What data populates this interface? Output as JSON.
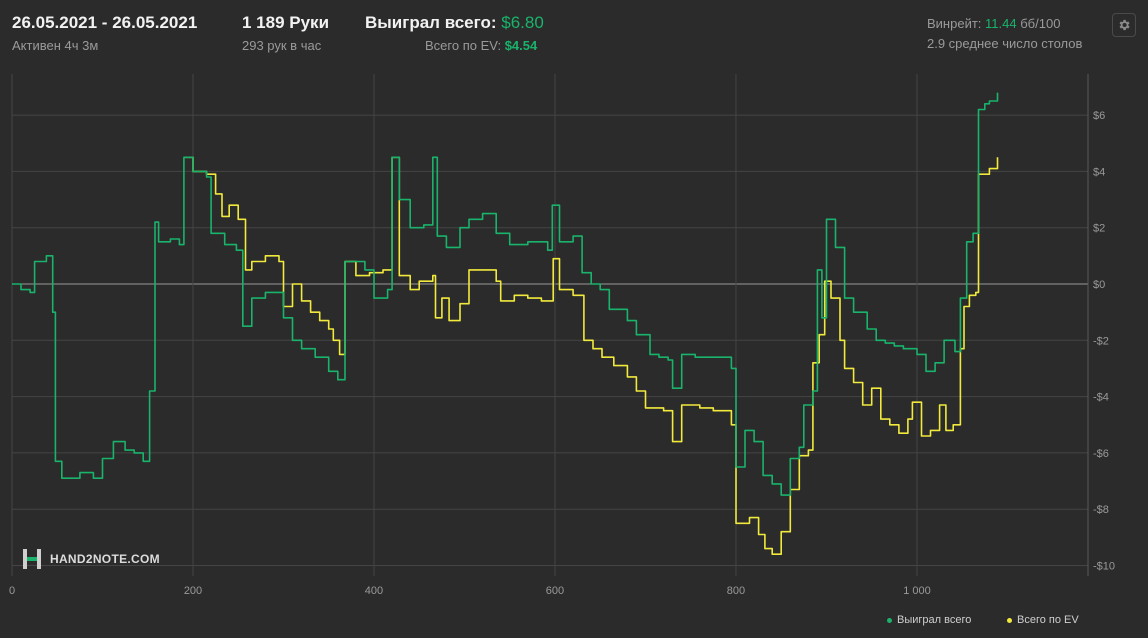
{
  "header": {
    "date_range": "26.05.2021 - 26.05.2021",
    "active": "Активен 4ч 3м",
    "hands": "1 189 Руки",
    "hands_per_hour": "293 рук в час",
    "won_total_label": "Выиграл всего:",
    "won_total_value": "$6.80",
    "ev_total_label": "Всего по EV:",
    "ev_total_value": "$4.54",
    "winrate_label": "Винрейт:",
    "winrate_value": "11.44",
    "winrate_unit": "бб/100",
    "avg_tables": "2.9 среднее число столов",
    "settings_icon": "gear-icon"
  },
  "logo": {
    "text": "HAND2NOTE.COM",
    "icon": "h2n-logo-icon"
  },
  "colors": {
    "won": "#19b36b",
    "ev": "#f1ea3c",
    "grid": "#454545",
    "zero": "#9a9a9a"
  },
  "chart_data": {
    "type": "line",
    "xlim": [
      0,
      1189
    ],
    "ylim": [
      -10,
      7
    ],
    "x_ticks": [
      0,
      200,
      400,
      600,
      800,
      1000
    ],
    "x_tick_labels": [
      "0",
      "200",
      "400",
      "600",
      "800",
      "1 000"
    ],
    "y_ticks": [
      6,
      4,
      2,
      0,
      -2,
      -4,
      -6,
      -8,
      -10
    ],
    "y_tick_labels": [
      "$6",
      "$4",
      "$2",
      "$0",
      "-$2",
      "-$4",
      "-$6",
      "-$8",
      "-$10"
    ],
    "grid": true,
    "legend_position": "bottom-right",
    "series": [
      {
        "name": "Выиграл всего",
        "color": "#19b36b",
        "points": [
          [
            0,
            0
          ],
          [
            10,
            -0.2
          ],
          [
            20,
            -0.3
          ],
          [
            25,
            0.8
          ],
          [
            38,
            1
          ],
          [
            45,
            -1
          ],
          [
            48,
            -6.3
          ],
          [
            55,
            -6.9
          ],
          [
            75,
            -6.7
          ],
          [
            90,
            -6.9
          ],
          [
            100,
            -6.2
          ],
          [
            112,
            -5.6
          ],
          [
            125,
            -5.9
          ],
          [
            135,
            -6
          ],
          [
            145,
            -6.3
          ],
          [
            152,
            -3.8
          ],
          [
            158,
            2.2
          ],
          [
            162,
            1.5
          ],
          [
            175,
            1.6
          ],
          [
            185,
            1.4
          ],
          [
            190,
            4.5
          ],
          [
            200,
            4
          ],
          [
            215,
            3.8
          ],
          [
            220,
            1.8
          ],
          [
            235,
            1.4
          ],
          [
            248,
            1.2
          ],
          [
            255,
            -1.5
          ],
          [
            265,
            -0.5
          ],
          [
            280,
            -0.3
          ],
          [
            300,
            -1.2
          ],
          [
            310,
            -2
          ],
          [
            320,
            -2.3
          ],
          [
            335,
            -2.6
          ],
          [
            350,
            -3.1
          ],
          [
            360,
            -3.4
          ],
          [
            368,
            0.8
          ],
          [
            380,
            0.8
          ],
          [
            390,
            0.5
          ],
          [
            400,
            -0.5
          ],
          [
            415,
            -0.2
          ],
          [
            420,
            4.5
          ],
          [
            428,
            3
          ],
          [
            440,
            2
          ],
          [
            455,
            2.1
          ],
          [
            465,
            4.5
          ],
          [
            470,
            1.7
          ],
          [
            480,
            1.3
          ],
          [
            495,
            2
          ],
          [
            505,
            2.3
          ],
          [
            520,
            2.5
          ],
          [
            535,
            1.8
          ],
          [
            550,
            1.4
          ],
          [
            570,
            1.5
          ],
          [
            580,
            1.5
          ],
          [
            592,
            1.2
          ],
          [
            597,
            2.8
          ],
          [
            605,
            1.5
          ],
          [
            620,
            1.7
          ],
          [
            630,
            0.4
          ],
          [
            640,
            0
          ],
          [
            650,
            -0.2
          ],
          [
            660,
            -0.9
          ],
          [
            680,
            -1.3
          ],
          [
            690,
            -1.8
          ],
          [
            705,
            -2.5
          ],
          [
            715,
            -2.6
          ],
          [
            725,
            -2.7
          ],
          [
            730,
            -3.7
          ],
          [
            740,
            -2.5
          ],
          [
            755,
            -2.6
          ],
          [
            775,
            -2.6
          ],
          [
            785,
            -2.6
          ],
          [
            795,
            -3
          ],
          [
            800,
            -6.5
          ],
          [
            810,
            -5.2
          ],
          [
            820,
            -5.6
          ],
          [
            830,
            -6.8
          ],
          [
            840,
            -7.1
          ],
          [
            850,
            -7.5
          ],
          [
            860,
            -6.2
          ],
          [
            870,
            -5.8
          ],
          [
            875,
            -4.3
          ],
          [
            885,
            -3.8
          ],
          [
            890,
            0.5
          ],
          [
            895,
            -1.2
          ],
          [
            900,
            2.3
          ],
          [
            910,
            1.3
          ],
          [
            920,
            -0.5
          ],
          [
            930,
            -1
          ],
          [
            945,
            -1.6
          ],
          [
            955,
            -2
          ],
          [
            965,
            -2.1
          ],
          [
            975,
            -2.2
          ],
          [
            985,
            -2.3
          ],
          [
            1000,
            -2.5
          ],
          [
            1010,
            -3.1
          ],
          [
            1020,
            -2.8
          ],
          [
            1030,
            -2
          ],
          [
            1042,
            -2.4
          ],
          [
            1048,
            -0.5
          ],
          [
            1055,
            1.5
          ],
          [
            1062,
            1.8
          ],
          [
            1068,
            6.2
          ],
          [
            1075,
            6.4
          ],
          [
            1080,
            6.5
          ],
          [
            1089,
            6.8
          ]
        ]
      },
      {
        "name": "Всего по EV",
        "color": "#f1ea3c",
        "points": [
          [
            190,
            4.5
          ],
          [
            200,
            4
          ],
          [
            215,
            3.9
          ],
          [
            225,
            3.2
          ],
          [
            232,
            2.4
          ],
          [
            240,
            2.8
          ],
          [
            250,
            2.3
          ],
          [
            258,
            0.5
          ],
          [
            265,
            0.8
          ],
          [
            280,
            1
          ],
          [
            295,
            0.8
          ],
          [
            300,
            -0.8
          ],
          [
            310,
            0
          ],
          [
            320,
            -0.6
          ],
          [
            330,
            -1
          ],
          [
            340,
            -1.3
          ],
          [
            350,
            -1.6
          ],
          [
            355,
            -2
          ],
          [
            362,
            -2.5
          ],
          [
            368,
            0.8
          ],
          [
            380,
            0.3
          ],
          [
            395,
            0.4
          ],
          [
            410,
            0.5
          ],
          [
            420,
            4.5
          ],
          [
            428,
            0.3
          ],
          [
            440,
            -0.2
          ],
          [
            450,
            0.1
          ],
          [
            465,
            0.3
          ],
          [
            468,
            -1.2
          ],
          [
            475,
            -0.5
          ],
          [
            483,
            -1.3
          ],
          [
            495,
            -0.7
          ],
          [
            505,
            0.5
          ],
          [
            520,
            0.5
          ],
          [
            535,
            0.1
          ],
          [
            540,
            -0.6
          ],
          [
            555,
            -0.4
          ],
          [
            570,
            -0.5
          ],
          [
            585,
            -0.6
          ],
          [
            598,
            0.9
          ],
          [
            605,
            -0.2
          ],
          [
            620,
            -0.4
          ],
          [
            632,
            -2
          ],
          [
            642,
            -2.3
          ],
          [
            652,
            -2.6
          ],
          [
            665,
            -2.9
          ],
          [
            680,
            -3.3
          ],
          [
            690,
            -3.8
          ],
          [
            700,
            -4.4
          ],
          [
            720,
            -4.5
          ],
          [
            730,
            -5.6
          ],
          [
            740,
            -4.3
          ],
          [
            760,
            -4.4
          ],
          [
            775,
            -4.5
          ],
          [
            785,
            -4.5
          ],
          [
            795,
            -5
          ],
          [
            800,
            -8.5
          ],
          [
            815,
            -8.3
          ],
          [
            825,
            -8.9
          ],
          [
            832,
            -9.4
          ],
          [
            840,
            -9.6
          ],
          [
            850,
            -8.8
          ],
          [
            860,
            -7.3
          ],
          [
            870,
            -6.1
          ],
          [
            880,
            -5.9
          ],
          [
            885,
            -2.8
          ],
          [
            892,
            -1.8
          ],
          [
            898,
            0.1
          ],
          [
            905,
            -0.5
          ],
          [
            915,
            -2
          ],
          [
            920,
            -3
          ],
          [
            930,
            -3.5
          ],
          [
            940,
            -4.3
          ],
          [
            950,
            -3.7
          ],
          [
            960,
            -4.8
          ],
          [
            970,
            -5
          ],
          [
            980,
            -5.3
          ],
          [
            990,
            -4.8
          ],
          [
            995,
            -4.2
          ],
          [
            1005,
            -5.4
          ],
          [
            1015,
            -5.2
          ],
          [
            1025,
            -4.3
          ],
          [
            1032,
            -5.2
          ],
          [
            1040,
            -5
          ],
          [
            1048,
            -2.3
          ],
          [
            1052,
            -0.8
          ],
          [
            1058,
            -0.4
          ],
          [
            1065,
            -0.3
          ],
          [
            1068,
            3.9
          ],
          [
            1080,
            4.1
          ],
          [
            1089,
            4.5
          ]
        ]
      }
    ]
  }
}
